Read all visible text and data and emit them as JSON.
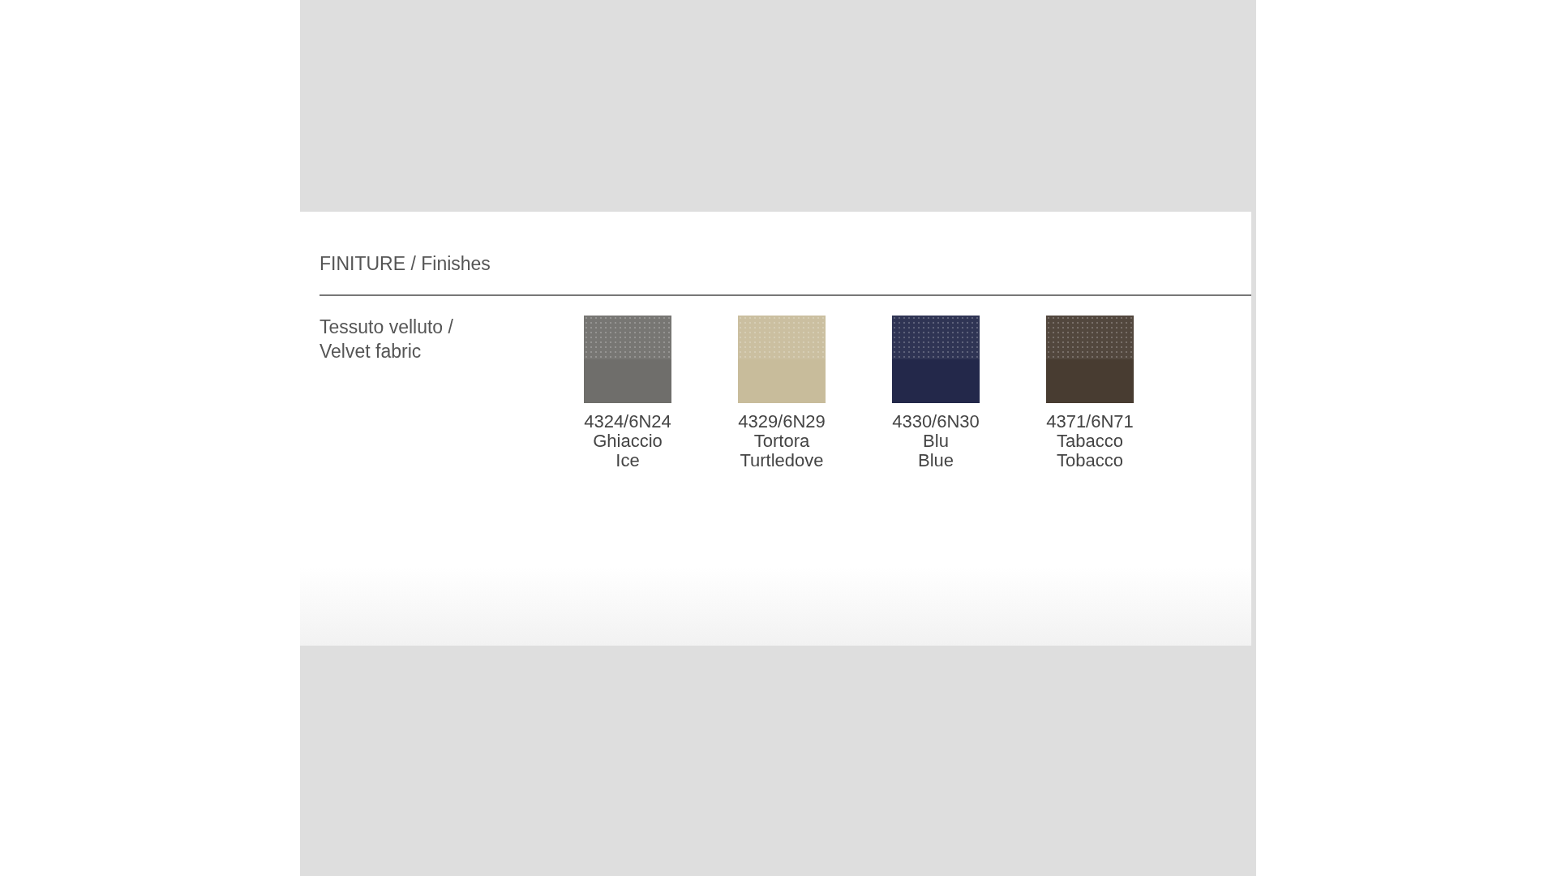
{
  "section": {
    "title": "FINITURE / Finishes"
  },
  "material": {
    "label_lines": [
      "Tessuto velluto /",
      "Velvet fabric"
    ]
  },
  "swatches": [
    {
      "code": "4324/6N24",
      "name_it": "Ghiaccio",
      "name_en": "Ice",
      "color": "#6f6e6b"
    },
    {
      "code": "4329/6N29",
      "name_it": "Tortora",
      "name_en": "Turtledove",
      "color": "#c8bc9b"
    },
    {
      "code": "4330/6N30",
      "name_it": "Blu",
      "name_en": "Blue",
      "color": "#23284a"
    },
    {
      "code": "4371/6N71",
      "name_it": "Tabacco",
      "name_en": "Tobacco",
      "color": "#483c31"
    }
  ]
}
